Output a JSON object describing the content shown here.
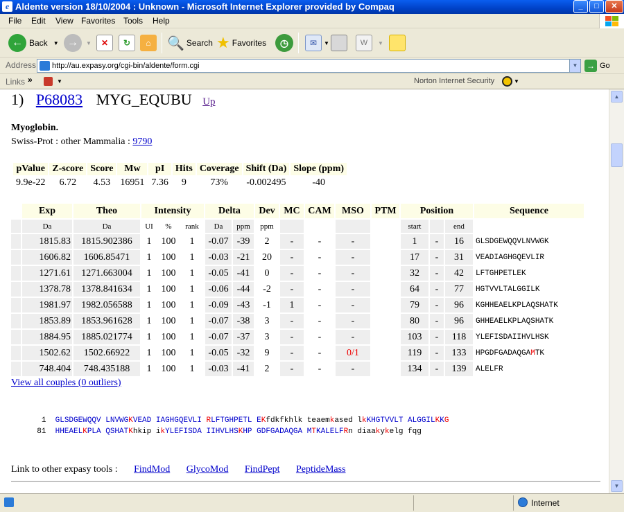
{
  "window": {
    "title": "Aldente version 18/10/2004 : Unknown - Microsoft Internet Explorer provided by Compaq"
  },
  "menu": [
    "File",
    "Edit",
    "View",
    "Favorites",
    "Tools",
    "Help"
  ],
  "toolbar": {
    "back": "Back",
    "search": "Search",
    "favorites": "Favorites"
  },
  "address": {
    "label": "Address",
    "url": "http://au.expasy.org/cgi-bin/aldente/form.cgi",
    "go": "Go"
  },
  "links": {
    "label": "Links",
    "norton": "Norton Internet Security"
  },
  "entry": {
    "index": "1)",
    "accession": "P68083",
    "name": "MYG_EQUBU",
    "up": "Up"
  },
  "protein": {
    "name": "Myoglobin.",
    "taxonomy_prefix": "Swiss-Prot : other Mammalia : ",
    "taxid": "9790"
  },
  "stats": {
    "headers": [
      "pValue",
      "Z-score",
      "Score",
      "Mw",
      "pI",
      "Hits",
      "Coverage",
      "Shift (Da)",
      "Slope (ppm)"
    ],
    "values": [
      "9.9e-22",
      "6.72",
      "4.53",
      "16951",
      "7.36",
      "9",
      "73%",
      "-0.002495",
      "-40"
    ]
  },
  "peptides": {
    "headers": [
      "Exp",
      "Theo",
      "Intensity",
      "Delta",
      "Dev",
      "MC",
      "CAM",
      "MSO",
      "PTM",
      "Position",
      "Sequence"
    ],
    "subheaders": [
      "Da",
      "Da",
      "UI",
      "%",
      "rank",
      "Da",
      "ppm",
      "ppm",
      "start",
      "end"
    ],
    "rows": [
      {
        "exp": "1815.83",
        "theo": "1815.902386",
        "ui": "1",
        "pct": "100",
        "rank": "1",
        "da": "-0.07",
        "ppm": "-39",
        "dev": "2",
        "mc": "-",
        "cam": "-",
        "mso": "-",
        "start": "1",
        "dash": "-",
        "end": "16",
        "seq": "GLSDGEWQQVLNVWGK"
      },
      {
        "exp": "1606.82",
        "theo": "1606.85471",
        "ui": "1",
        "pct": "100",
        "rank": "1",
        "da": "-0.03",
        "ppm": "-21",
        "dev": "20",
        "mc": "-",
        "cam": "-",
        "mso": "-",
        "start": "17",
        "dash": "-",
        "end": "31",
        "seq": "VEADIAGHGQEVLIR"
      },
      {
        "exp": "1271.61",
        "theo": "1271.663004",
        "ui": "1",
        "pct": "100",
        "rank": "1",
        "da": "-0.05",
        "ppm": "-41",
        "dev": "0",
        "mc": "-",
        "cam": "-",
        "mso": "-",
        "start": "32",
        "dash": "-",
        "end": "42",
        "seq": "LFTGHPETLEK"
      },
      {
        "exp": "1378.78",
        "theo": "1378.841634",
        "ui": "1",
        "pct": "100",
        "rank": "1",
        "da": "-0.06",
        "ppm": "-44",
        "dev": "-2",
        "mc": "-",
        "cam": "-",
        "mso": "-",
        "start": "64",
        "dash": "-",
        "end": "77",
        "seq": "HGTVVLTALGGILK"
      },
      {
        "exp": "1981.97",
        "theo": "1982.056588",
        "ui": "1",
        "pct": "100",
        "rank": "1",
        "da": "-0.09",
        "ppm": "-43",
        "dev": "-1",
        "mc": "1",
        "cam": "-",
        "mso": "-",
        "start": "79",
        "dash": "-",
        "end": "96",
        "seq": "KGHHEAELKPLAQSHATK"
      },
      {
        "exp": "1853.89",
        "theo": "1853.961628",
        "ui": "1",
        "pct": "100",
        "rank": "1",
        "da": "-0.07",
        "ppm": "-38",
        "dev": "3",
        "mc": "-",
        "cam": "-",
        "mso": "-",
        "start": "80",
        "dash": "-",
        "end": "96",
        "seq": "GHHEAELKPLAQSHATK"
      },
      {
        "exp": "1884.95",
        "theo": "1885.021774",
        "ui": "1",
        "pct": "100",
        "rank": "1",
        "da": "-0.07",
        "ppm": "-37",
        "dev": "3",
        "mc": "-",
        "cam": "-",
        "mso": "-",
        "start": "103",
        "dash": "-",
        "end": "118",
        "seq": "YLEFISDAIIHVLHSK"
      },
      {
        "exp": "1502.62",
        "theo": "1502.66922",
        "ui": "1",
        "pct": "100",
        "rank": "1",
        "da": "-0.05",
        "ppm": "-32",
        "dev": "9",
        "mc": "-",
        "cam": "-",
        "mso": "0/1",
        "start": "119",
        "dash": "-",
        "end": "133",
        "seq": "HPGDFGADAQGAMTK"
      },
      {
        "exp": "748.404",
        "theo": "748.435188",
        "ui": "1",
        "pct": "100",
        "rank": "1",
        "da": "-0.03",
        "ppm": "-41",
        "dev": "2",
        "mc": "-",
        "cam": "-",
        "mso": "-",
        "start": "134",
        "dash": "-",
        "end": "139",
        "seq": "ALELFR"
      }
    ]
  },
  "view_all": "View all couples (0 outliers)",
  "sequence": {
    "line1_num": "1",
    "line2_num": "81"
  },
  "tools": {
    "label": "Link to other expasy tools :",
    "links": [
      "FindMod",
      "GlycoMod",
      "FindPept",
      "PeptideMass"
    ]
  },
  "status": {
    "zone": "Internet"
  }
}
